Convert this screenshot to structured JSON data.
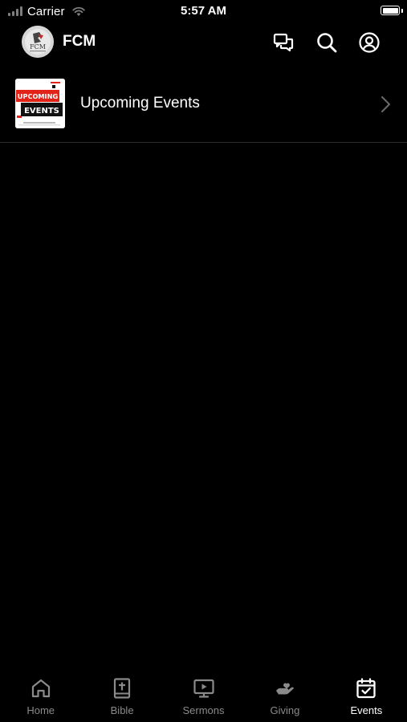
{
  "status_bar": {
    "carrier": "Carrier",
    "time": "5:57 AM"
  },
  "header": {
    "title": "FCM",
    "logo_text": "FCM",
    "icons": [
      "chat-icon",
      "search-icon",
      "account-icon"
    ]
  },
  "list": {
    "items": [
      {
        "label": "Upcoming Events",
        "thumbnail_text_top": "UPCOMING",
        "thumbnail_text_bottom": "EVENTS"
      }
    ]
  },
  "tab_bar": {
    "active": "Events",
    "tabs": [
      {
        "label": "Home",
        "icon": "home-icon"
      },
      {
        "label": "Bible",
        "icon": "bible-icon"
      },
      {
        "label": "Sermons",
        "icon": "sermons-icon"
      },
      {
        "label": "Giving",
        "icon": "giving-icon"
      },
      {
        "label": "Events",
        "icon": "calendar-check-icon"
      }
    ]
  },
  "colors": {
    "background": "#000000",
    "text": "#ffffff",
    "inactive_tab": "#8a8a8a",
    "thumbnail_accent": "#e2231a"
  }
}
